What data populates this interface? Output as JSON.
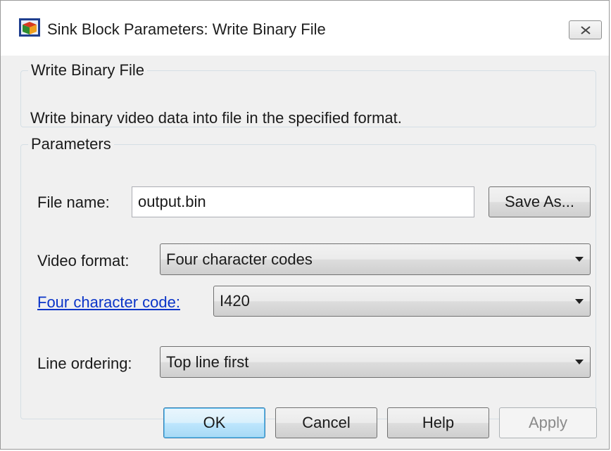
{
  "window": {
    "title": "Sink Block Parameters: Write Binary File",
    "close_icon": "close-icon"
  },
  "description": {
    "heading": "Write Binary File",
    "text": "Write binary video data into file in the specified format."
  },
  "parameters": {
    "heading": "Parameters",
    "file_name": {
      "label": "File name:",
      "value": "output.bin",
      "button_label": "Save As..."
    },
    "video_format": {
      "label": "Video format:",
      "value": "Four character codes"
    },
    "four_character_code": {
      "label": "Four character code:",
      "value": "I420",
      "link_color": "#0a34c8"
    },
    "line_ordering": {
      "label": "Line ordering:",
      "value": "Top line first"
    }
  },
  "buttons": {
    "ok": "OK",
    "cancel": "Cancel",
    "help": "Help",
    "apply": "Apply"
  },
  "colors": {
    "accent_default_button": "#3c7fb1",
    "disabled_text": "#8a8a8a"
  }
}
